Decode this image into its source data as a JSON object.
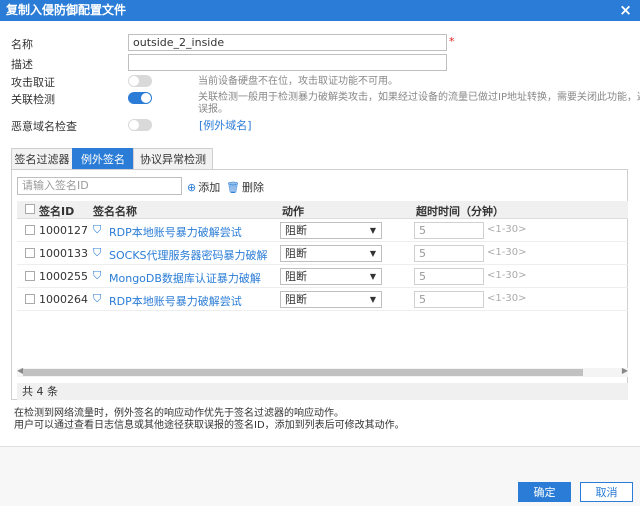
{
  "dialog": {
    "title": "复制入侵防御配置文件",
    "close_glyph": "×"
  },
  "form": {
    "name_label": "名称",
    "name_value": "outside_2_inside",
    "required_mark": "*",
    "desc_label": "描述",
    "desc_value": "",
    "attack_label": "攻击取证",
    "attack_on": false,
    "attack_hint": "当前设备硬盘不在位，攻击取证功能不可用。",
    "corr_label": "关联检测",
    "corr_on": true,
    "corr_hint_1": "关联检测一般用于检测暴力破解类攻击，如果经过设备的流量已做过IP地址转换，需要关闭此功能，避免",
    "corr_hint_2": "误报。",
    "domain_label": "恶意域名检查",
    "domain_on": false,
    "domain_link": "[例外域名]"
  },
  "tabs": [
    {
      "label": "签名过滤器",
      "active": false
    },
    {
      "label": "例外签名",
      "active": true
    },
    {
      "label": "协议异常检测",
      "active": false
    }
  ],
  "toolbar": {
    "search_placeholder": "请输入签名ID",
    "add_icon": "⊕",
    "add_label": "添加",
    "delete_icon": "🗑",
    "delete_label": "删除"
  },
  "table": {
    "headers": {
      "id": "签名ID",
      "name": "签名名称",
      "action": "动作",
      "timeout": "超时时间（分钟）"
    },
    "rows": [
      {
        "id": "1000127",
        "name": "RDP本地账号暴力破解尝试",
        "action": "阻断",
        "timeout": "5",
        "range": "<1-30>"
      },
      {
        "id": "1000133",
        "name": "SOCKS代理服务器密码暴力破解",
        "action": "阻断",
        "timeout": "5",
        "range": "<1-30>"
      },
      {
        "id": "1000255",
        "name": "MongoDB数据库认证暴力破解",
        "action": "阻断",
        "timeout": "5",
        "range": "<1-30>"
      },
      {
        "id": "1000264",
        "name": "RDP本地账号暴力破解尝试",
        "action": "阻断",
        "timeout": "5",
        "range": "<1-30>"
      }
    ],
    "total": "共 4 条"
  },
  "notes": {
    "line1": "在检测到网络流量时，例外签名的响应动作优先于签名过滤器的响应动作。",
    "line2": "用户可以通过查看日志信息或其他途径获取误报的签名ID，添加到列表后可修改其动作。"
  },
  "buttons": {
    "ok": "确定",
    "cancel": "取消"
  }
}
